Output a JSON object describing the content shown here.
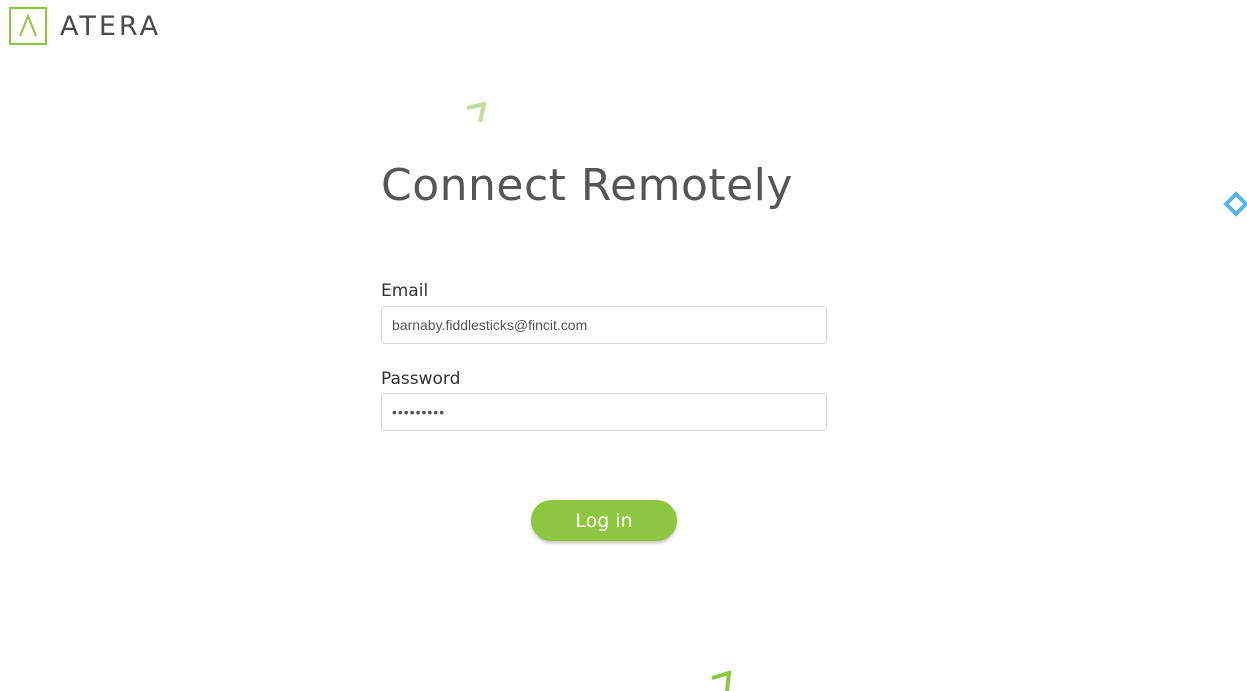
{
  "brand": {
    "name": "ATERA",
    "accent_color": "#8dc63f",
    "logo_icon": "atera-caret-icon"
  },
  "page": {
    "title": "Connect Remotely"
  },
  "form": {
    "email_label": "Email",
    "email_value": "barnaby.fiddlesticks@fincit.com",
    "password_label": "Password",
    "password_value": "•••••••••",
    "login_label": "Log in"
  },
  "decorations": {
    "top_icon": "green-caret-icon",
    "bottom_icon": "green-caret-icon",
    "side_icon": "blue-diamond-icon",
    "side_color": "#5bb3e6"
  }
}
